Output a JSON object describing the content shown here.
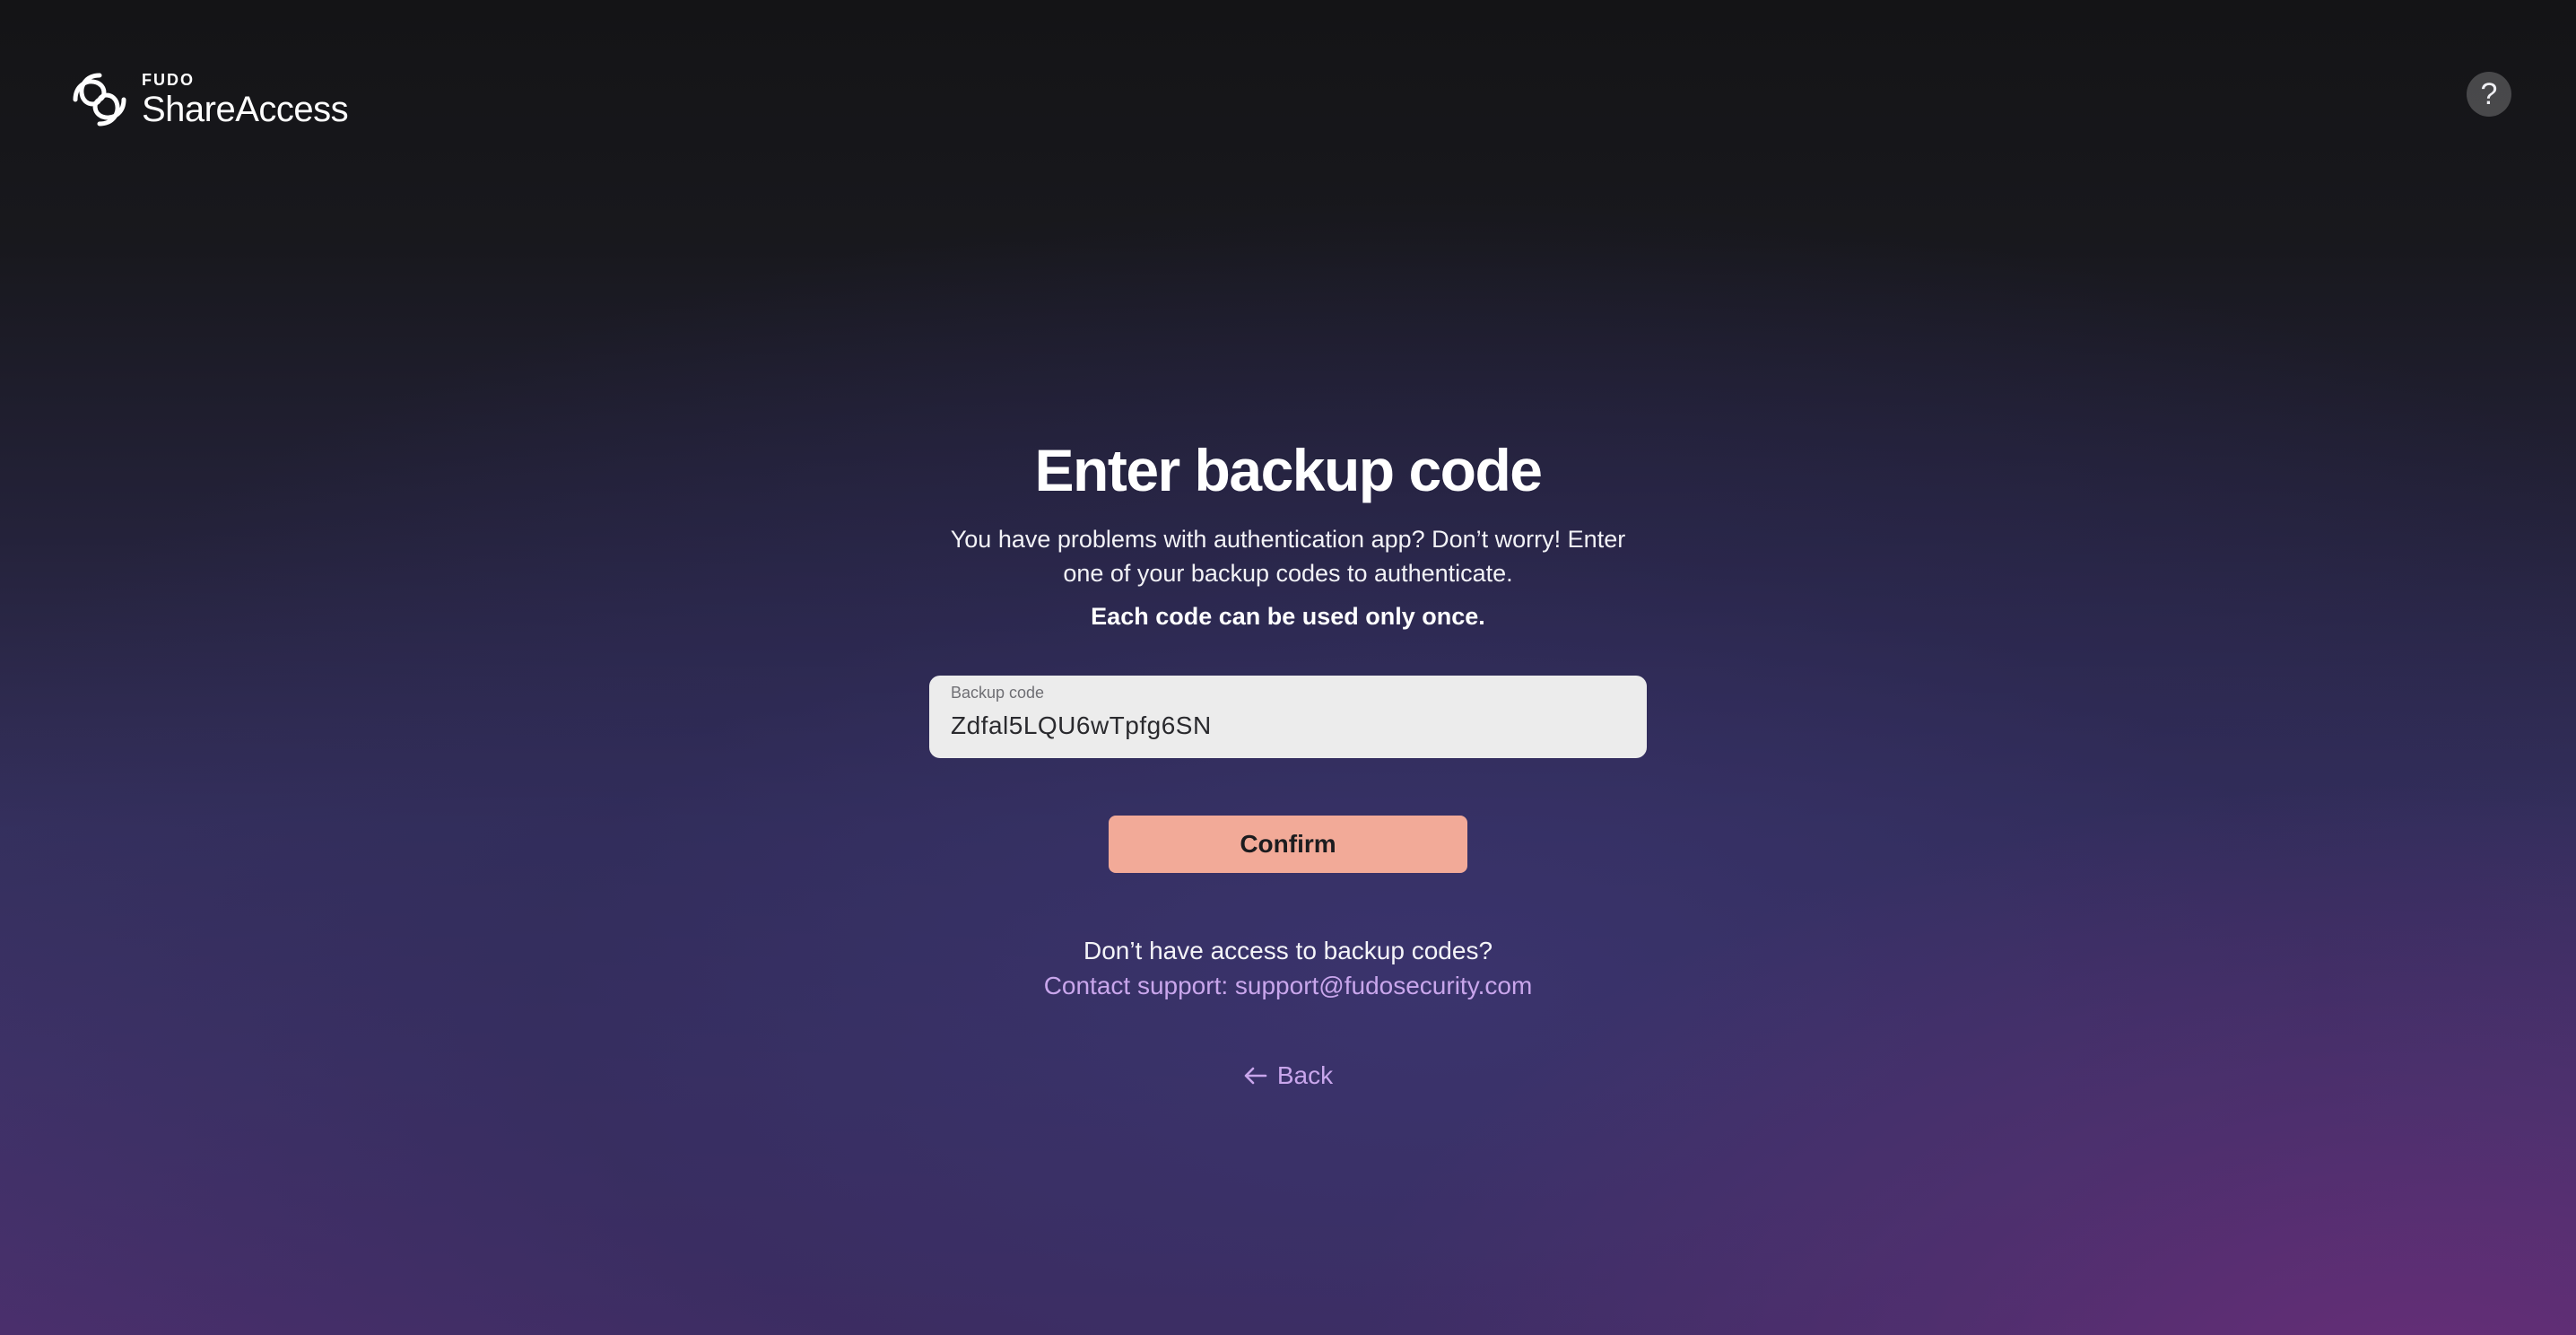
{
  "header": {
    "logo": {
      "brand": "FUDO",
      "product": "ShareAccess",
      "icon": "fudo-logo-icon"
    },
    "help": {
      "label": "?",
      "icon": "help-icon"
    }
  },
  "main": {
    "title": "Enter backup code",
    "description": "You have problems with authentication app? Don’t worry! Enter one of your backup codes to authenticate.",
    "note": "Each code can be used only once.",
    "backup_field": {
      "label": "Backup code",
      "value": "Zdfal5LQU6wTpfg6SN"
    },
    "confirm_label": "Confirm",
    "support": {
      "question": "Don’t have access to backup codes?",
      "link_text": "Contact support: support@fudosecurity.com"
    },
    "back": {
      "label": "Back",
      "icon": "arrow-left-icon"
    }
  },
  "colors": {
    "accent_button": "#f2aa98",
    "link": "#c9a6ec",
    "field_background": "#ececec"
  }
}
